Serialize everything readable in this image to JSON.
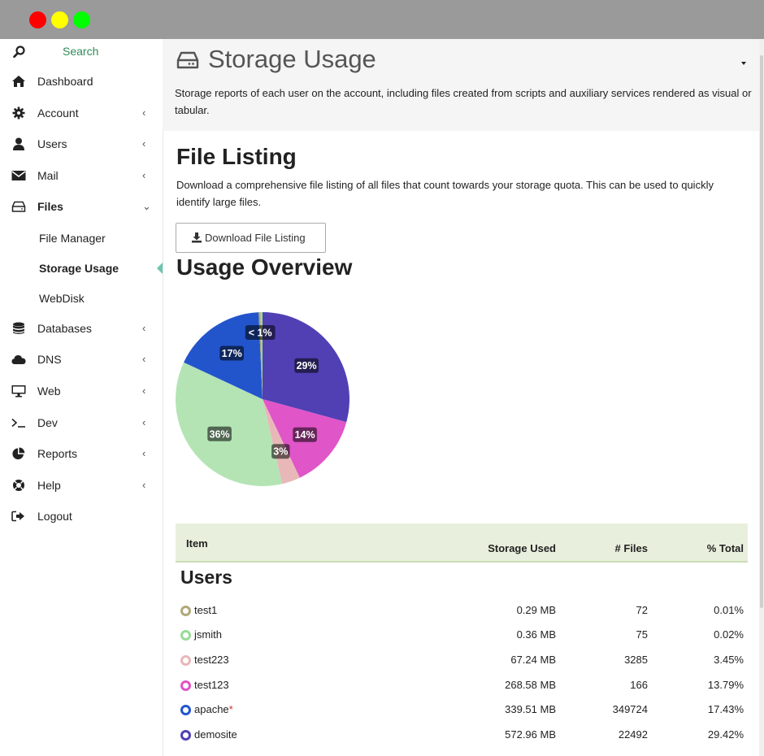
{
  "sidebar": {
    "search_label": "Search",
    "items": [
      {
        "label": "Dashboard",
        "icon": "home-icon",
        "chevron": ""
      },
      {
        "label": "Account",
        "icon": "gear-icon",
        "chevron": "‹"
      },
      {
        "label": "Users",
        "icon": "user-icon",
        "chevron": "‹"
      },
      {
        "label": "Mail",
        "icon": "envelope-icon",
        "chevron": "‹"
      },
      {
        "label": "Files",
        "icon": "hdd-icon",
        "chevron": "⌄"
      },
      {
        "label": "Databases",
        "icon": "database-icon",
        "chevron": "‹"
      },
      {
        "label": "DNS",
        "icon": "cloud-icon",
        "chevron": "‹"
      },
      {
        "label": "Web",
        "icon": "monitor-icon",
        "chevron": "‹"
      },
      {
        "label": "Dev",
        "icon": "terminal-icon",
        "chevron": "‹"
      },
      {
        "label": "Reports",
        "icon": "pie-chart-icon",
        "chevron": "‹"
      },
      {
        "label": "Help",
        "icon": "lifebuoy-icon",
        "chevron": "‹"
      },
      {
        "label": "Logout",
        "icon": "sign-out-icon",
        "chevron": ""
      }
    ],
    "files_sub": [
      {
        "label": "File Manager"
      },
      {
        "label": "Storage Usage"
      },
      {
        "label": "WebDisk"
      }
    ]
  },
  "header": {
    "title": "Storage Usage",
    "description": "Storage reports of each user on the account, including files created from scripts and auxiliary services rendered as visual or tabular."
  },
  "file_listing": {
    "title": "File Listing",
    "description": "Download a comprehensive file listing of all files that count towards your storage quota. This can be used to quickly identify large files.",
    "button_label": "Download File Listing"
  },
  "usage": {
    "title": "Usage Overview"
  },
  "chart_data": {
    "type": "pie",
    "title": "",
    "slices": [
      {
        "label": "29%",
        "value": 29.42,
        "color": "#5040b4"
      },
      {
        "label": "14%",
        "value": 13.79,
        "color": "#e055c8"
      },
      {
        "label": "3%",
        "value": 3.45,
        "color": "#e8b8b8"
      },
      {
        "label": "36%",
        "value": 35.78,
        "color": "#b4e4b4"
      },
      {
        "label": "17%",
        "value": 17.43,
        "color": "#2255cc"
      },
      {
        "label": "< 1%",
        "value": 0.01,
        "color": "#b0a878"
      },
      {
        "label": "",
        "value": 0.02,
        "color": "#98dc98"
      }
    ]
  },
  "table": {
    "headers": {
      "item": "Item",
      "used": "Storage Used",
      "files": "# Files",
      "pct": "% Total"
    },
    "section": "Users",
    "rows": [
      {
        "name": "test1",
        "used": "0.29 MB",
        "files": "72",
        "pct": "0.01%",
        "color": "#b0a878",
        "mark": ""
      },
      {
        "name": "jsmith",
        "used": "0.36 MB",
        "files": "75",
        "pct": "0.02%",
        "color": "#98dc98",
        "mark": ""
      },
      {
        "name": "test223",
        "used": "67.24 MB",
        "files": "3285",
        "pct": "3.45%",
        "color": "#e8b8b8",
        "mark": ""
      },
      {
        "name": "test123",
        "used": "268.58 MB",
        "files": "166",
        "pct": "13.79%",
        "color": "#e055c8",
        "mark": ""
      },
      {
        "name": "apache",
        "used": "339.51 MB",
        "files": "349724",
        "pct": "17.43%",
        "color": "#2255cc",
        "mark": "*"
      },
      {
        "name": "demosite",
        "used": "572.96 MB",
        "files": "22492",
        "pct": "29.42%",
        "color": "#5040b4",
        "mark": ""
      }
    ]
  }
}
